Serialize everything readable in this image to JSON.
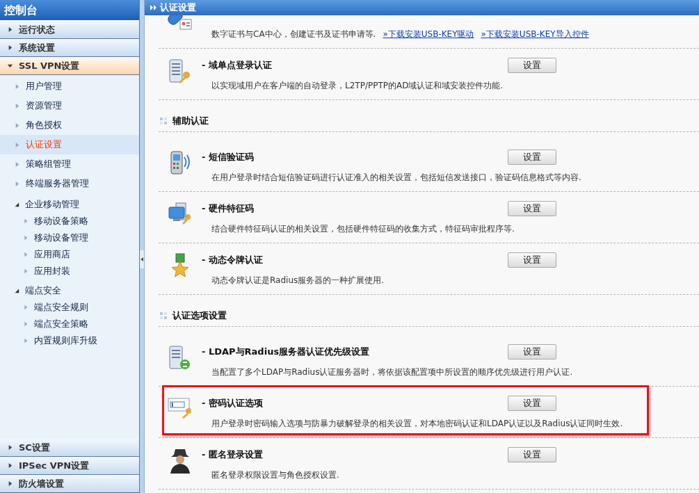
{
  "sidebar": {
    "title": "控制台",
    "sections": [
      {
        "label": "运行状态",
        "expanded": false,
        "selected": false
      },
      {
        "label": "系统设置",
        "expanded": false,
        "selected": false
      },
      {
        "label": "SSL VPN设置",
        "expanded": true,
        "selected": true,
        "children": [
          {
            "label": "用户管理",
            "selected": false
          },
          {
            "label": "资源管理",
            "selected": false
          },
          {
            "label": "角色授权",
            "selected": false
          },
          {
            "label": "认证设置",
            "selected": true
          },
          {
            "label": "策略组管理",
            "selected": false
          },
          {
            "label": "终端服务器管理",
            "selected": false
          },
          {
            "label": "企业移动管理",
            "selected": false,
            "expanded": true,
            "children": [
              {
                "label": "移动设备策略",
                "selected": false
              },
              {
                "label": "移动设备管理",
                "selected": false
              },
              {
                "label": "应用商店",
                "selected": false
              },
              {
                "label": "应用封装",
                "selected": false
              }
            ]
          },
          {
            "label": "端点安全",
            "selected": false,
            "expanded": true,
            "children": [
              {
                "label": "端点安全规则",
                "selected": false
              },
              {
                "label": "端点安全策略",
                "selected": false
              },
              {
                "label": "内置规则库升级",
                "selected": false
              }
            ]
          }
        ]
      },
      {
        "label": "SC设置",
        "expanded": false,
        "selected": false
      },
      {
        "label": "IPSec VPN设置",
        "expanded": false,
        "selected": false
      },
      {
        "label": "防火墙设置",
        "expanded": false,
        "selected": false
      }
    ]
  },
  "main": {
    "title": "认证设置",
    "blocks": [
      {
        "kind": "item",
        "description": "数字证书与CA中心，创建证书及证书申请等.",
        "links": [
          "»下载安装USB-KEY驱动",
          "»下载安装USB-KEY导入控件"
        ],
        "highlighted": false
      },
      {
        "kind": "item",
        "title": "- 域单点登录认证",
        "description": "以实现域用户在客户端的自动登录，L2TP/PPTP的AD域认证和域安装控件功能.",
        "button": "设置",
        "highlighted": false
      },
      {
        "kind": "heading",
        "title": "辅助认证"
      },
      {
        "kind": "item",
        "title": "- 短信验证码",
        "description": "在用户登录时结合短信验证码进行认证准入的相关设置，包括短信发送接口，验证码信息格式等内容.",
        "button": "设置",
        "highlighted": false
      },
      {
        "kind": "item",
        "title": "- 硬件特征码",
        "description": "结合硬件特征码认证的相关设置，包括硬件特征码的收集方式，特征码审批程序等.",
        "button": "设置",
        "highlighted": false
      },
      {
        "kind": "item",
        "title": "- 动态令牌认证",
        "description": "动态令牌认证是Radius服务器的一种扩展使用.",
        "button": "设置",
        "highlighted": false
      },
      {
        "kind": "heading",
        "title": "认证选项设置"
      },
      {
        "kind": "item",
        "title": "- LDAP与Radius服务器认证优先级设置",
        "description": "当配置了多个LDAP与Radius认证服务器时，将依据该配置项中所设置的顺序优先级进行用户认证.",
        "button": "设置",
        "highlighted": false
      },
      {
        "kind": "item",
        "title": "- 密码认证选项",
        "description": "用户登录时密码输入选项与防暴力破解登录的相关设置，对本地密码认证和LDAP认证以及Radius认证同时生效.",
        "button": "设置",
        "highlighted": true
      },
      {
        "kind": "item",
        "title": "- 匿名登录设置",
        "description": "匿名登录权限设置与角色授权设置.",
        "button": "设置",
        "highlighted": false
      }
    ]
  }
}
